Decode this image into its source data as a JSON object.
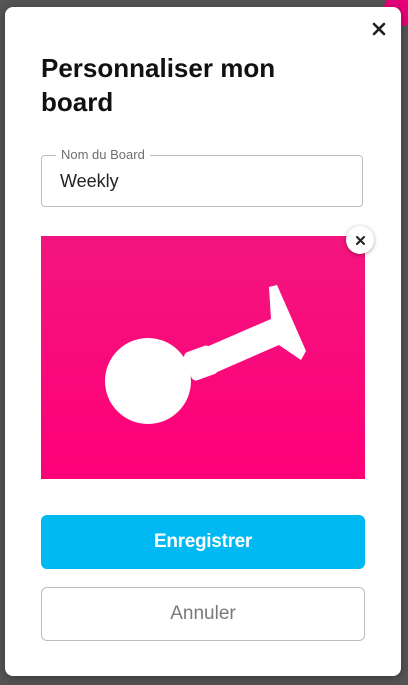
{
  "modal": {
    "title": "Personnaliser mon board",
    "close_icon": "close-icon"
  },
  "board_name_field": {
    "label": "Nom du Board",
    "value": "Weekly"
  },
  "board_image": {
    "icon": "horn-icon",
    "background_color": "#ff0078",
    "remove_icon": "close-icon"
  },
  "actions": {
    "save_label": "Enregistrer",
    "cancel_label": "Annuler"
  },
  "colors": {
    "primary": "#00b9f2",
    "image_background": "#ff0078"
  }
}
